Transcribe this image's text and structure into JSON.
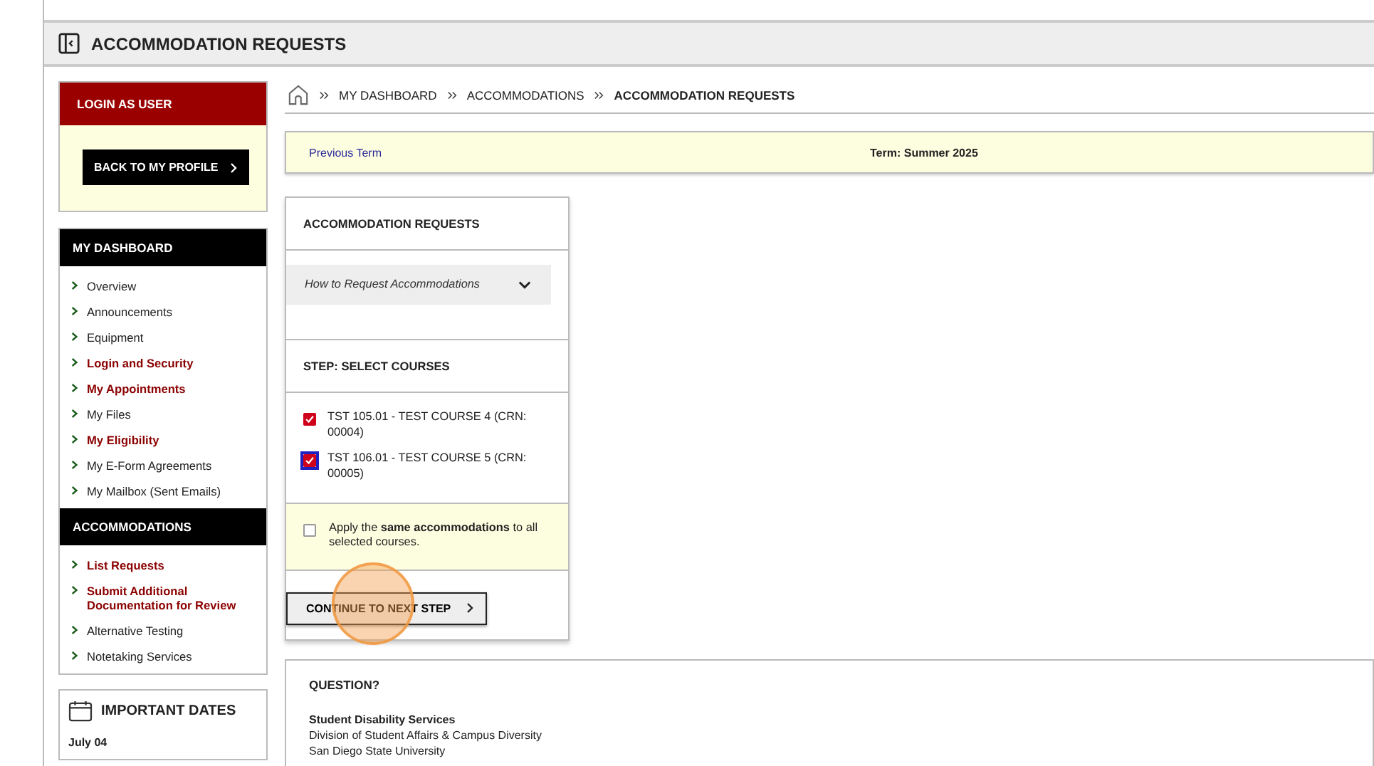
{
  "header": {
    "title": "ACCOMMODATION REQUESTS"
  },
  "sidebar": {
    "login_panel": {
      "title": "LOGIN AS USER",
      "button": "BACK TO MY PROFILE"
    },
    "sections": [
      {
        "title": "MY DASHBOARD",
        "items": [
          {
            "label": "Overview",
            "emphasized": false
          },
          {
            "label": "Announcements",
            "emphasized": false
          },
          {
            "label": "Equipment",
            "emphasized": false
          },
          {
            "label": "Login and Security",
            "emphasized": true
          },
          {
            "label": "My Appointments",
            "emphasized": true
          },
          {
            "label": "My Files",
            "emphasized": false
          },
          {
            "label": "My Eligibility",
            "emphasized": true
          },
          {
            "label": "My E-Form Agreements",
            "emphasized": false
          },
          {
            "label": "My Mailbox (Sent Emails)",
            "emphasized": false
          }
        ]
      },
      {
        "title": "ACCOMMODATIONS",
        "items": [
          {
            "label": "List Requests",
            "emphasized": true
          },
          {
            "label": "Submit Additional Documentation for Review",
            "emphasized": true
          },
          {
            "label": "Alternative Testing",
            "emphasized": false
          },
          {
            "label": "Notetaking Services",
            "emphasized": false
          }
        ]
      }
    ],
    "important_dates": {
      "title": "IMPORTANT DATES",
      "first_date": "July 04"
    }
  },
  "breadcrumb": [
    "MY DASHBOARD",
    "ACCOMMODATIONS",
    "ACCOMMODATION REQUESTS"
  ],
  "term_bar": {
    "link": "Previous Term",
    "term": "Term: Summer 2025"
  },
  "request_card": {
    "title": "ACCOMMODATION REQUESTS",
    "accordion": {
      "label": "How to Request Accommodations",
      "expanded": false
    },
    "step_title": "STEP: SELECT COURSES",
    "courses": [
      {
        "label": "TST 105.01 - TEST COURSE 4 (CRN: 00004)",
        "checked": true,
        "focused": false
      },
      {
        "label": "TST 106.01 - TEST COURSE 5 (CRN: 00005)",
        "checked": true,
        "focused": true
      }
    ],
    "apply_same": {
      "label": "Apply the **same accommodations** to all selected courses.",
      "checked": false
    },
    "button": "CONTINUE TO NEXT STEP"
  },
  "question_card": {
    "title": "QUESTION?",
    "org": "Student Disability Services",
    "lines": [
      "Division of Student Affairs & Campus Diversity",
      "San Diego State University"
    ]
  }
}
